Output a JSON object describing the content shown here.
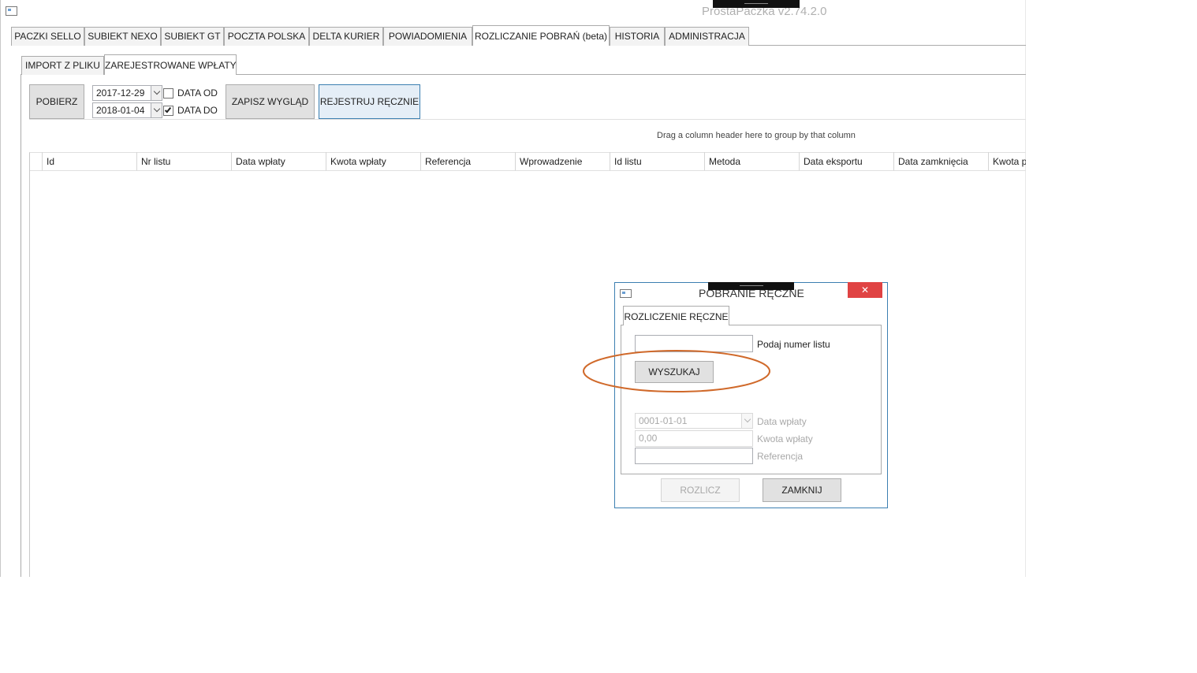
{
  "window": {
    "title": "ProstaPaczka v2.74.2.0"
  },
  "main_tabs": [
    {
      "label": "PACZKI SELLO"
    },
    {
      "label": "SUBIEKT NEXO"
    },
    {
      "label": "SUBIEKT GT"
    },
    {
      "label": "POCZTA POLSKA"
    },
    {
      "label": "DELTA KURIER"
    },
    {
      "label": "POWIADOMIENIA"
    },
    {
      "label": "ROZLICZANIE POBRAŃ (beta)",
      "active": true
    },
    {
      "label": "HISTORIA"
    },
    {
      "label": "ADMINISTRACJA"
    }
  ],
  "sub_tabs": [
    {
      "label": "IMPORT Z PLIKU"
    },
    {
      "label": "ZAREJESTROWANE WPŁATY",
      "active": true
    }
  ],
  "toolbar": {
    "fetch_label": "POBIERZ",
    "date_from": {
      "value": "2017-12-29",
      "label": "DATA OD",
      "checked": false
    },
    "date_to": {
      "value": "2018-01-04",
      "label": "DATA DO",
      "checked": true
    },
    "save_layout_label": "ZAPISZ WYGLĄD",
    "register_manual_label": "REJESTRUJ RĘCZNIE"
  },
  "grid": {
    "group_hint": "Drag a column header here to group by that column",
    "columns": [
      "Id",
      "Nr listu",
      "Data wpłaty",
      "Kwota wpłaty",
      "Referencja",
      "Wprowadzenie",
      "Id listu",
      "Metoda",
      "Data eksportu",
      "Data zamknięcia",
      "Kwota p"
    ]
  },
  "dialog": {
    "title": "POBRANIE RĘCZNE",
    "close_symbol": "✕",
    "tab_label": "ROZLICZENIE RĘCZNE",
    "search_input": {
      "value": "",
      "label": "Podaj numer listu"
    },
    "search_button_label": "WYSZUKAJ",
    "payment_date": {
      "value": "0001-01-01",
      "label": "Data wpłaty"
    },
    "payment_amount": {
      "value": "0,00",
      "label": "Kwota wpłaty"
    },
    "reference": {
      "value": "",
      "label": "Referencja"
    },
    "settle_button_label": "ROZLICZ",
    "close_button_label": "ZAMKNIJ"
  },
  "annotation": {
    "color": "#d0692a"
  },
  "colors": {
    "accent_border": "#3c7fb1",
    "close_button": "#e04343"
  }
}
